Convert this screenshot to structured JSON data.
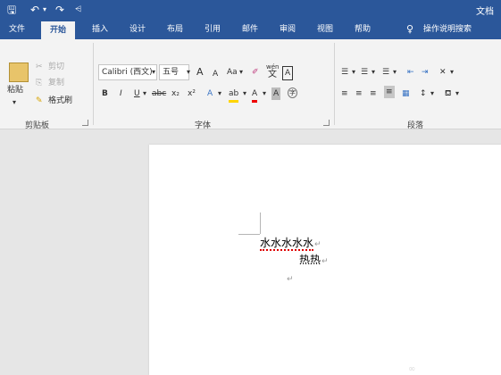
{
  "titlebar": {
    "title": "文档"
  },
  "tabs": [
    "文件",
    "开始",
    "插入",
    "设计",
    "布局",
    "引用",
    "邮件",
    "审阅",
    "视图",
    "帮助"
  ],
  "tellme": "操作说明搜索",
  "clipboard": {
    "paste": "粘贴",
    "cut": "剪切",
    "copy": "复制",
    "format_painter": "格式刷",
    "group": "剪贴板"
  },
  "font": {
    "name": "Calibri (西文)",
    "size": "五号",
    "group": "字体",
    "aa": "Aa",
    "phonetic": "wén",
    "phonetic_char": "文",
    "border_char": "A",
    "bold": "B",
    "italic": "I",
    "underline": "U",
    "strike": "abc",
    "sub": "x₂",
    "sup": "x²",
    "grow": "A",
    "shrink": "A",
    "effect": "A",
    "highlight": "ab",
    "color": "A",
    "shade": "A",
    "enclose": "字"
  },
  "paragraph": {
    "group": "段落"
  },
  "document": {
    "line1": "水水水水水",
    "line2": "热热"
  }
}
